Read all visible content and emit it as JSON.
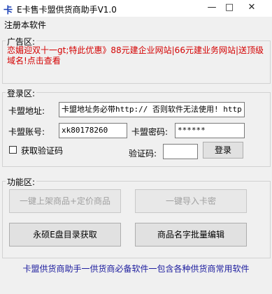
{
  "window": {
    "icon_glyph": "卡",
    "title": "E卡售卡盟供货商助手V1.0",
    "minimize": "—",
    "maximize": "□",
    "close": "✕"
  },
  "menu": {
    "register": "注册本软件"
  },
  "ad": {
    "legend": "广告区:",
    "text": "恋媚迎双十一gt;特此优惠》88元建企业网站|66元建业务网站|送顶级域名!点击查看"
  },
  "login": {
    "legend": "登录区:",
    "address_label": "卡盟地址:",
    "address_value": "卡盟地址务必带http:// 否则软件无法使用! http",
    "account_label": "卡盟账号:",
    "account_value": "xk80178260",
    "password_label": "卡盟密码:",
    "password_value": "******",
    "captcha_checkbox_label": "获取验证码",
    "captcha_label": "验证码:",
    "captcha_value": "",
    "login_button": "登录"
  },
  "functions": {
    "legend": "功能区:",
    "btn_list_price": "一键上架商品+定价商品",
    "btn_import_cards": "一键导入卡密",
    "btn_yongshuo": "永硕E盘目录获取",
    "btn_batch_rename": "商品名字批量编辑"
  },
  "footer": {
    "text": "卡盟供货商助手一供货商必备软件一包含各种供货商常用软件"
  }
}
